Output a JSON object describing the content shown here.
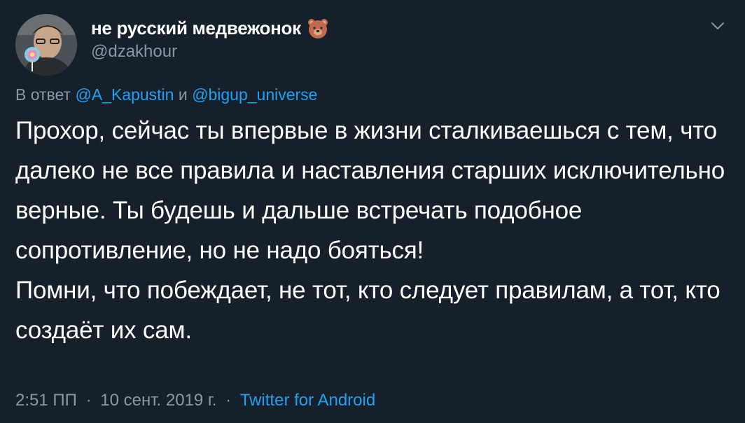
{
  "author": {
    "display_name": "не русский медвежонок",
    "emoji_icon": "bear-face-icon",
    "handle": "@dzakhour"
  },
  "reply": {
    "prefix": "В ответ",
    "user1": "@A_Kapustin",
    "conjunction": "и",
    "user2": "@bigup_universe"
  },
  "tweet": {
    "paragraph1": "Прохор, сейчас ты впервые в жизни сталкиваешься с тем, что далеко не все правила и наставления старших исключительно верные. Ты будешь и дальше встречать подобное сопротивление, но не надо бояться!",
    "paragraph2": "Помни, что побеждает, не тот, кто следует правилам, а тот, кто создаёт их сам."
  },
  "meta": {
    "time": "2:51 ПП",
    "date": "10 сент. 2019 г.",
    "separator": "·",
    "source": "Twitter for Android"
  },
  "colors": {
    "background": "#15202b",
    "text": "#ffffff",
    "secondary": "#8899a6",
    "link": "#1da1f2"
  }
}
